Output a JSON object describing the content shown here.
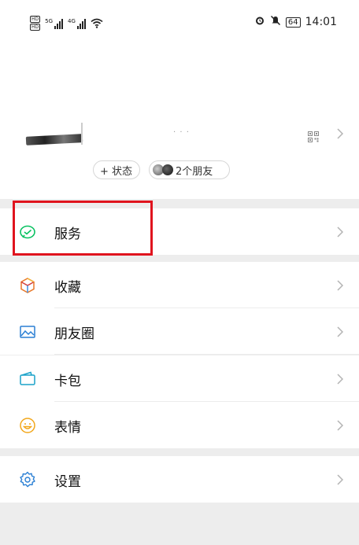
{
  "status_bar": {
    "hd1": "HD",
    "hd2": "HD",
    "sig1_label": "5G",
    "sig2_label": "4G",
    "battery": "64",
    "time": "14:01"
  },
  "profile": {
    "name_hint": "· · ·",
    "status_chip": "+ 状态",
    "friends_chip": "2个朋友"
  },
  "menu": {
    "services": "服务",
    "favorites": "收藏",
    "moments": "朋友圈",
    "cards": "卡包",
    "stickers": "表情",
    "settings": "设置"
  },
  "colors": {
    "highlight": "#e0141e",
    "wechat_green": "#07c160",
    "page_bg": "#ededed"
  }
}
